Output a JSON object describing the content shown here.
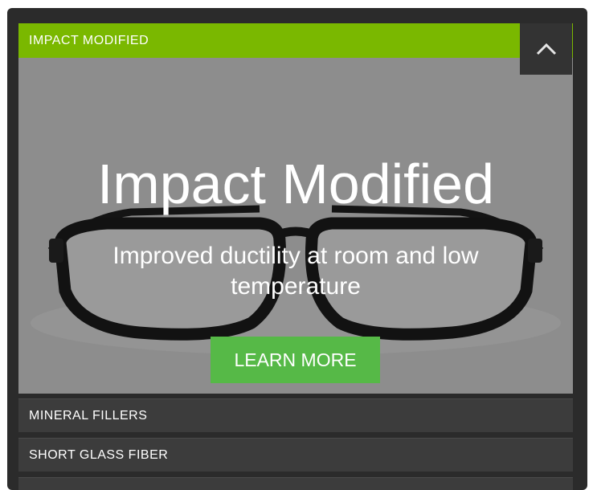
{
  "accordion": {
    "open_panel": {
      "header": "IMPACT MODIFIED",
      "hero_title": "Impact Modified",
      "hero_subtitle": "Improved ductility at room and low temperature",
      "cta_label": "LEARN MORE"
    },
    "items": [
      {
        "label": "MINERAL FILLERS"
      },
      {
        "label": "SHORT GLASS FIBER"
      },
      {
        "label": ""
      }
    ],
    "collapse_icon": "chevron-up-icon"
  },
  "colors": {
    "header_accent": "#7ab800",
    "cta": "#56b947",
    "panel_dark": "#3c3c3c",
    "frame": "#2b2b2b"
  }
}
